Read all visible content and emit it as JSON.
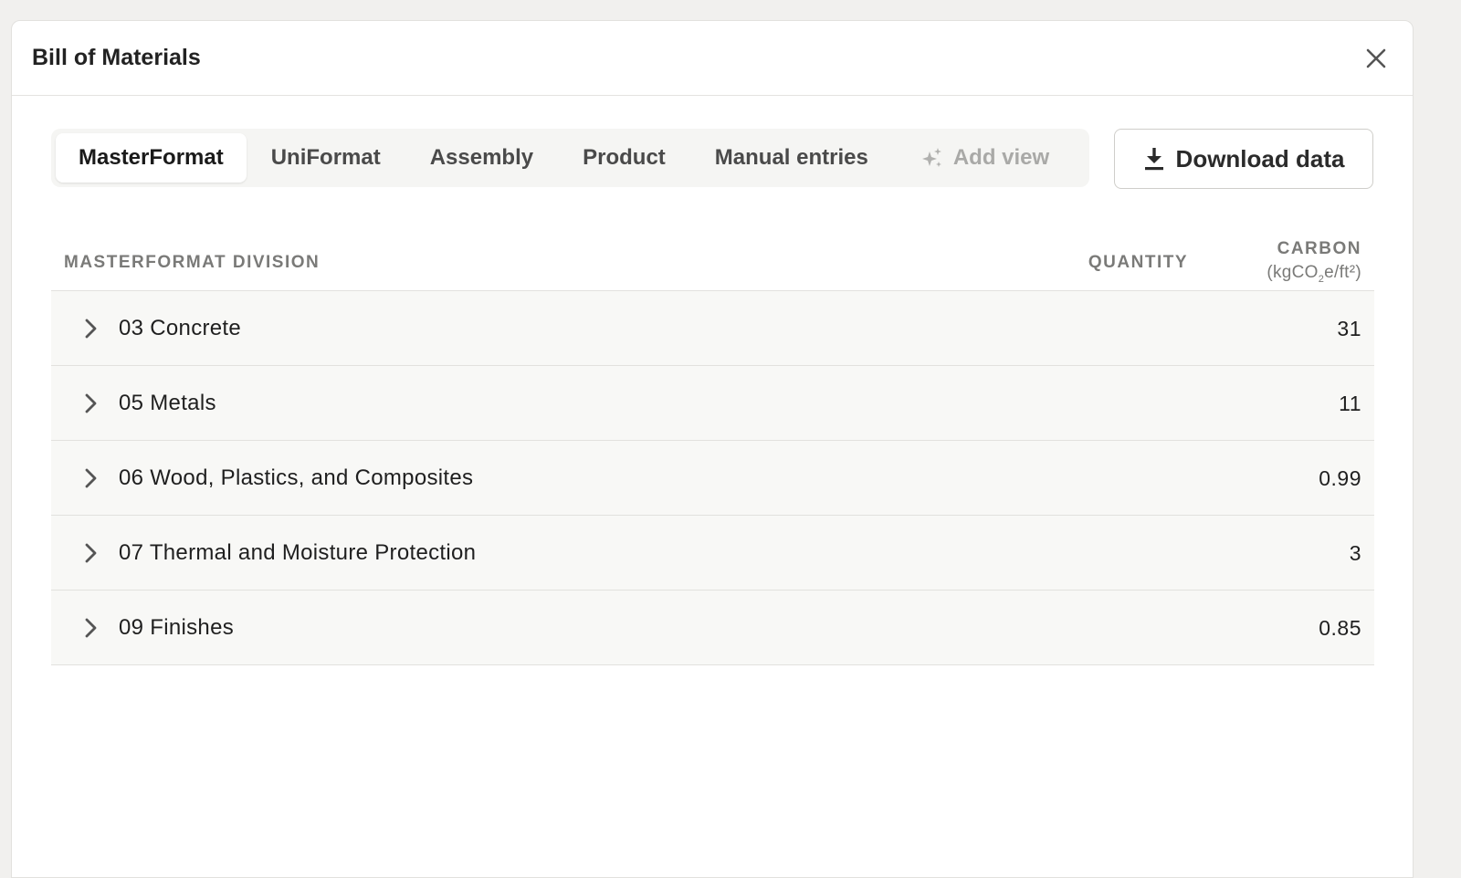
{
  "modal": {
    "title": "Bill of Materials"
  },
  "tabs": [
    {
      "label": "MasterFormat",
      "active": true
    },
    {
      "label": "UniFormat",
      "active": false
    },
    {
      "label": "Assembly",
      "active": false
    },
    {
      "label": "Product",
      "active": false
    },
    {
      "label": "Manual entries",
      "active": false
    }
  ],
  "add_view_label": "Add view",
  "download_label": "Download data",
  "table": {
    "headers": {
      "division": "MASTERFORMAT DIVISION",
      "quantity": "QUANTITY",
      "carbon": "CARBON",
      "carbon_unit_prefix": "(kgCO",
      "carbon_unit_sub": "2",
      "carbon_unit_suffix": "e/ft²)"
    },
    "rows": [
      {
        "label": "03 Concrete",
        "quantity": "",
        "carbon": "31"
      },
      {
        "label": "05 Metals",
        "quantity": "",
        "carbon": "11"
      },
      {
        "label": "06 Wood, Plastics, and Composites",
        "quantity": "",
        "carbon": "0.99"
      },
      {
        "label": "07 Thermal and Moisture Protection",
        "quantity": "",
        "carbon": "3"
      },
      {
        "label": "09 Finishes",
        "quantity": "",
        "carbon": "0.85"
      }
    ]
  },
  "icons": {
    "close": "close-icon",
    "sparkle": "sparkle-icon",
    "download": "download-icon",
    "chevron": "chevron-right-icon"
  }
}
